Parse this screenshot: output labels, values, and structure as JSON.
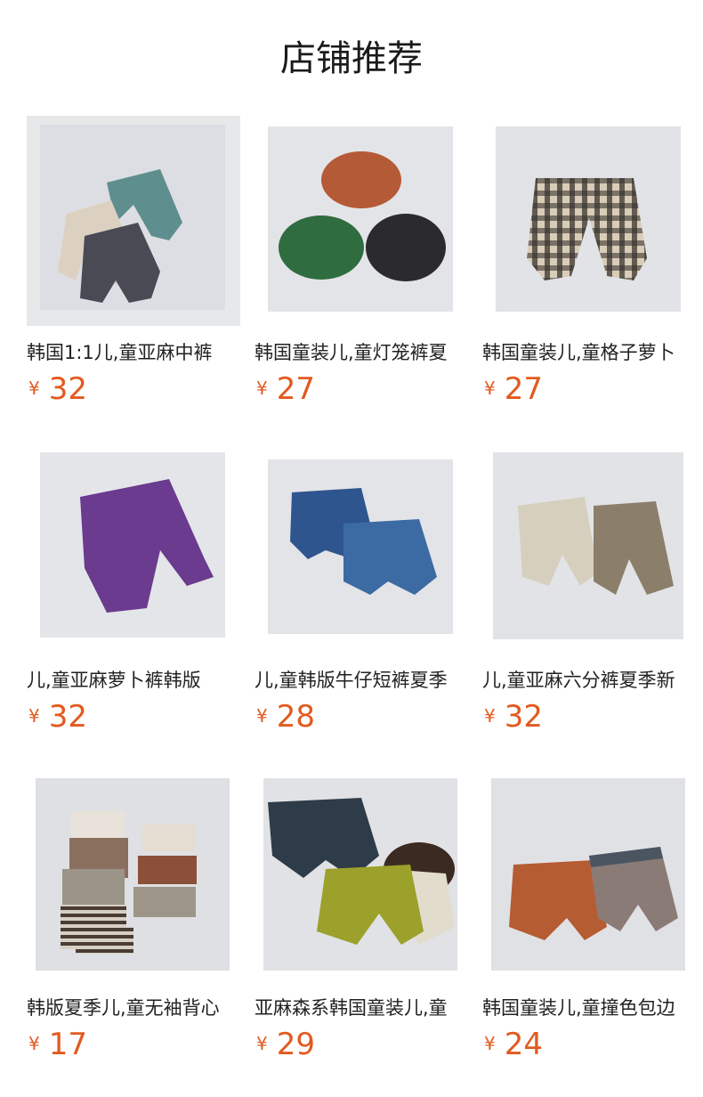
{
  "header": {
    "title": "店铺推荐"
  },
  "products": [
    {
      "name": "韩国1:1儿,童亚麻中裤",
      "currency": "¥",
      "price": "32",
      "image_icon": "teal-beige-grey-shorts-image",
      "accent": "#5f8e8f"
    },
    {
      "name": "韩国童装儿,童灯笼裤夏",
      "currency": "¥",
      "price": "27",
      "image_icon": "rust-green-black-bloomers-image",
      "accent": "#b55a36"
    },
    {
      "name": "韩国童装儿,童格子萝卜",
      "currency": "¥",
      "price": "27",
      "image_icon": "plaid-pants-image",
      "accent": "#3b3530"
    },
    {
      "name": "儿,童亚麻萝卜裤韩版",
      "currency": "¥",
      "price": "32",
      "image_icon": "purple-pants-image",
      "accent": "#6a3b8e"
    },
    {
      "name": "儿,童韩版牛仔短裤夏季",
      "currency": "¥",
      "price": "28",
      "image_icon": "denim-shorts-image",
      "accent": "#3c6aa3"
    },
    {
      "name": "儿,童亚麻六分裤夏季新",
      "currency": "¥",
      "price": "32",
      "image_icon": "linen-cropped-pants-image",
      "accent": "#b8ad98"
    },
    {
      "name": "韩版夏季儿,童无袖背心",
      "currency": "¥",
      "price": "17",
      "image_icon": "tank-top-sets-image",
      "accent": "#8a6f5e"
    },
    {
      "name": "亚麻森系韩国童装儿,童",
      "currency": "¥",
      "price": "29",
      "image_icon": "lime-navy-linen-shorts-image",
      "accent": "#9ba12a"
    },
    {
      "name": "韩国童装儿,童撞色包边",
      "currency": "¥",
      "price": "24",
      "image_icon": "colorblock-shorts-image",
      "accent": "#b65c33"
    }
  ]
}
